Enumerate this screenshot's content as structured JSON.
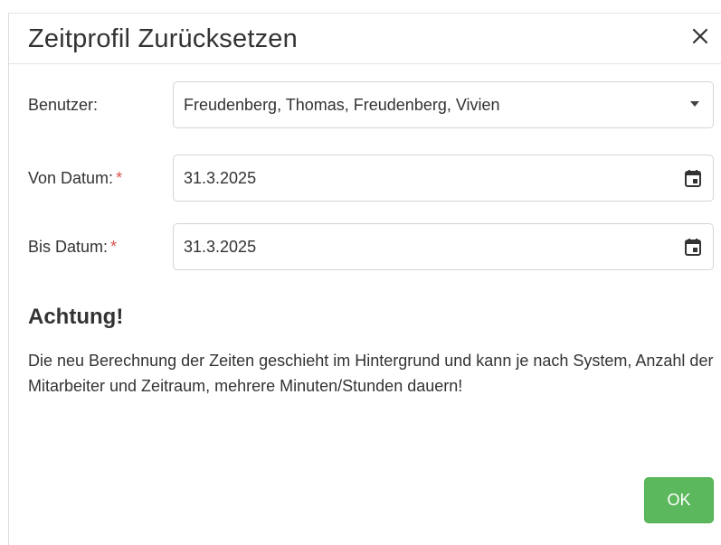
{
  "dialog": {
    "title": "Zeitprofil Zurücksetzen",
    "close_icon": "close-icon"
  },
  "form": {
    "user": {
      "label": "Benutzer:",
      "value": "Freudenberg, Thomas, Freudenberg, Vivien",
      "icon": "chevron-down-icon"
    },
    "from_date": {
      "label": "Von Datum:",
      "required_mark": "*",
      "value": "31.3.2025",
      "icon": "calendar-icon"
    },
    "to_date": {
      "label": "Bis Datum:",
      "required_mark": "*",
      "value": "31.3.2025",
      "icon": "calendar-icon"
    }
  },
  "warning": {
    "title": "Achtung!",
    "text": "Die neu Berechnung der Zeiten geschieht im Hintergrund und kann je nach System, Anzahl der Mitarbeiter und Zeitraum, mehrere Minuten/Stunden dauern!"
  },
  "actions": {
    "ok_label": "OK"
  },
  "colors": {
    "ok_button": "#5cb85c",
    "required": "#d9534f"
  }
}
